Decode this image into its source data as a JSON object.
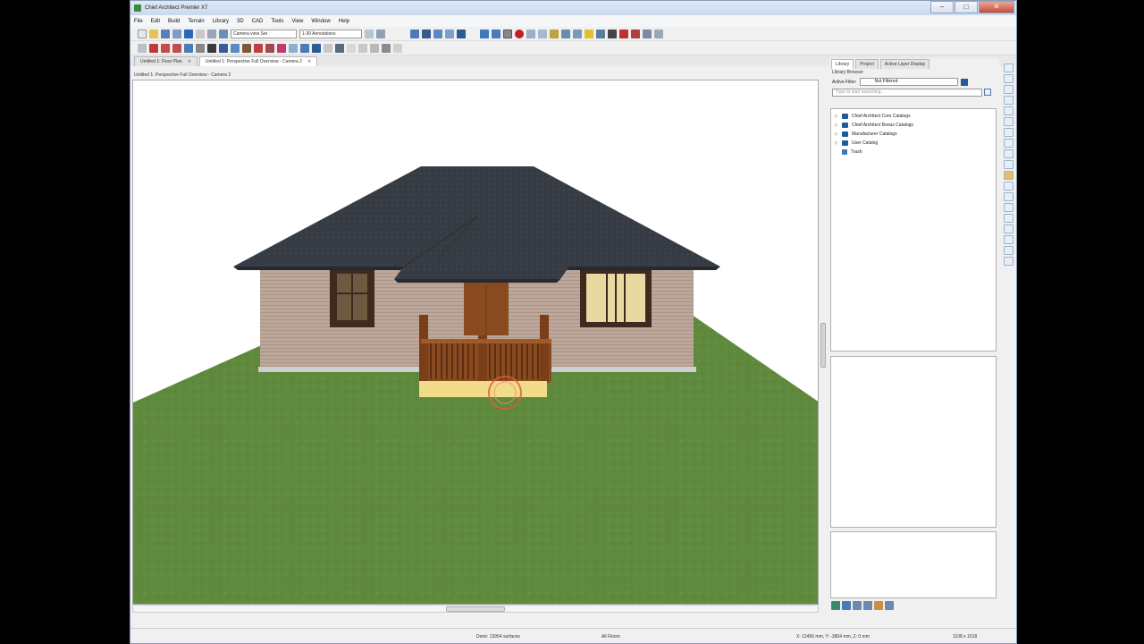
{
  "window": {
    "title": "Chief Architect Premier X7",
    "controls": [
      "–",
      "□",
      "✕"
    ]
  },
  "menu": [
    "File",
    "Edit",
    "Build",
    "Terrain",
    "Library",
    "3D",
    "CAD",
    "Tools",
    "View",
    "Window",
    "Help"
  ],
  "toolbar": {
    "camera_view_set": "Camera view Set",
    "annotation_set": "1-30 Annotations"
  },
  "tabs": [
    {
      "label": "Untitled 1: Floor Plan",
      "active": false
    },
    {
      "label": "Untitled 1: Perspective Full Overview - Camera 2",
      "active": true
    }
  ],
  "viewport": {
    "header": "Untitled 1: Perspective Full Overview - Camera 2"
  },
  "side": {
    "tabs": [
      "Library",
      "Project",
      "Active Layer Display"
    ],
    "header": "Library Browser",
    "filter_label": "Active Filter:",
    "filter_value": "Not Filtered",
    "search_placeholder": "Type to start searching...",
    "tree": [
      {
        "label": "Chief Architect Core Catalogs",
        "type": "folder"
      },
      {
        "label": "Chief Architect Bonus Catalogs",
        "type": "folder"
      },
      {
        "label": "Manufacturer Catalogs",
        "type": "folder"
      },
      {
        "label": "User Catalog",
        "type": "folder"
      },
      {
        "label": "Trash",
        "type": "trash"
      }
    ]
  },
  "status": {
    "done": "Done: 13954 surfaces",
    "floors": "All Floors",
    "coords": "X: 12456 mm, Y: -3804 mm, Z: 0 mm",
    "size": "1108 x 1018"
  },
  "colors": {
    "grass": "#5f8a3e",
    "roof": "#373c44",
    "siding": "#bca79a",
    "trim": "#4a3325",
    "porch": "#8a4a20",
    "accent": "#1f5b9c"
  }
}
